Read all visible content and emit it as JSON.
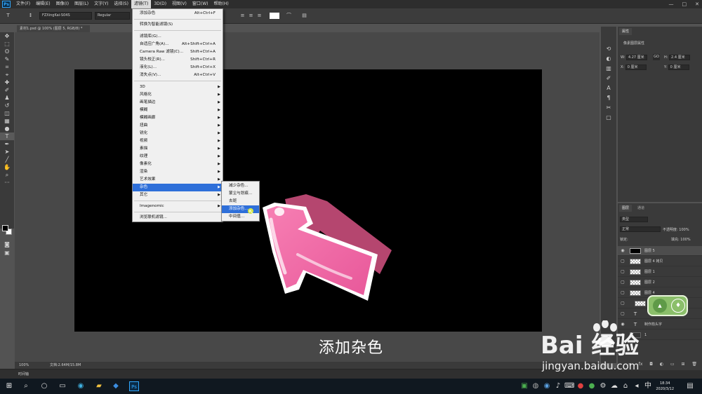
{
  "menubar": {
    "logo": "Ps",
    "items": [
      "文件(F)",
      "编辑(E)",
      "图像(I)",
      "图层(L)",
      "文字(Y)",
      "选择(S)",
      "滤镜(T)",
      "3D(D)",
      "视图(V)",
      "窗口(W)",
      "帮助(H)"
    ],
    "window_controls": [
      "—",
      "□",
      "✕"
    ]
  },
  "options": {
    "font_family": "FZXingKai-S04S",
    "font_style": "Regular"
  },
  "document": {
    "tab_label": "素材1.psd @ 100% (图层 5, RGB/8) *",
    "status": "文档:2.64M/15.8M",
    "zoom": "100%",
    "timeline": "时间轴"
  },
  "filter_menu": {
    "items": [
      {
        "label": "添加杂色",
        "shortcut": "Alt+Ctrl+F",
        "arrow": false
      },
      {
        "label": "转换为智能滤镜(S)",
        "shortcut": "",
        "arrow": false
      },
      {
        "label": "滤镜库(G)...",
        "shortcut": "",
        "arrow": false
      },
      {
        "label": "自适应广角(A)...",
        "shortcut": "Alt+Shift+Ctrl+A",
        "arrow": false
      },
      {
        "label": "Camera Raw 滤镜(C)...",
        "shortcut": "Shift+Ctrl+A",
        "arrow": false
      },
      {
        "label": "镜头校正(R)...",
        "shortcut": "Shift+Ctrl+R",
        "arrow": false
      },
      {
        "label": "液化(L)...",
        "shortcut": "Shift+Ctrl+X",
        "arrow": false
      },
      {
        "label": "消失点(V)...",
        "shortcut": "Alt+Ctrl+V",
        "arrow": false
      },
      {
        "label": "3D",
        "shortcut": "",
        "arrow": true
      },
      {
        "label": "风格化",
        "shortcut": "",
        "arrow": true
      },
      {
        "label": "画笔描边",
        "shortcut": "",
        "arrow": true
      },
      {
        "label": "模糊",
        "shortcut": "",
        "arrow": true
      },
      {
        "label": "模糊画廊",
        "shortcut": "",
        "arrow": true
      },
      {
        "label": "扭曲",
        "shortcut": "",
        "arrow": true
      },
      {
        "label": "锐化",
        "shortcut": "",
        "arrow": true
      },
      {
        "label": "视频",
        "shortcut": "",
        "arrow": true
      },
      {
        "label": "素描",
        "shortcut": "",
        "arrow": true
      },
      {
        "label": "纹理",
        "shortcut": "",
        "arrow": true
      },
      {
        "label": "像素化",
        "shortcut": "",
        "arrow": true
      },
      {
        "label": "渲染",
        "shortcut": "",
        "arrow": true
      },
      {
        "label": "艺术效果",
        "shortcut": "",
        "arrow": true
      },
      {
        "label": "杂色",
        "shortcut": "",
        "arrow": true
      },
      {
        "label": "其它",
        "shortcut": "",
        "arrow": true
      },
      {
        "label": "Imagenomic",
        "shortcut": "",
        "arrow": true
      },
      {
        "label": "浏览联机滤镜...",
        "shortcut": "",
        "arrow": false
      }
    ]
  },
  "noise_menu": {
    "items": [
      "减少杂色...",
      "蒙尘与划痕...",
      "去斑",
      "添加杂色...",
      "中间值..."
    ],
    "highlighted": 3
  },
  "properties": {
    "tab": "属性",
    "title": "像素图层属性",
    "w_label": "W:",
    "w_value": "4.27 厘米",
    "h_label": "H:",
    "h_value": "2.4 厘米",
    "x_label": "X:",
    "x_value": "0 厘米",
    "y_label": "Y:",
    "y_value": "0 厘米",
    "link_label": "GO"
  },
  "layers": {
    "tabs": [
      "图层",
      "通道"
    ],
    "filter": "类型",
    "blend_mode": "正常",
    "opacity_label": "不透明度:",
    "opacity": "100%",
    "lock_label": "锁定:",
    "fill_label": "填充:",
    "fill": "100%",
    "rows": [
      {
        "name": "图层 5",
        "type": "black",
        "visible": true
      },
      {
        "name": "图层 4 拷贝",
        "type": "pixel",
        "visible": false
      },
      {
        "name": "图层 1",
        "type": "pixel",
        "visible": false
      },
      {
        "name": "图层 2",
        "type": "pixel",
        "visible": false
      },
      {
        "name": "图层 4",
        "type": "pixel",
        "visible": false
      },
      {
        "name": "",
        "type": "pixel",
        "visible": false
      },
      {
        "name": "",
        "type": "text",
        "visible": false
      },
      {
        "name": "制作箭头字",
        "type": "text",
        "visible": true
      },
      {
        "name": "1",
        "type": "pixel",
        "visible": true
      }
    ]
  },
  "canvas": {
    "caption": "添加杂色"
  },
  "taskbar": {
    "time": "18:34",
    "date": "2020/3/12"
  },
  "watermark": {
    "brand": "Bai  经验",
    "url": "jingyan.baidu.com"
  }
}
